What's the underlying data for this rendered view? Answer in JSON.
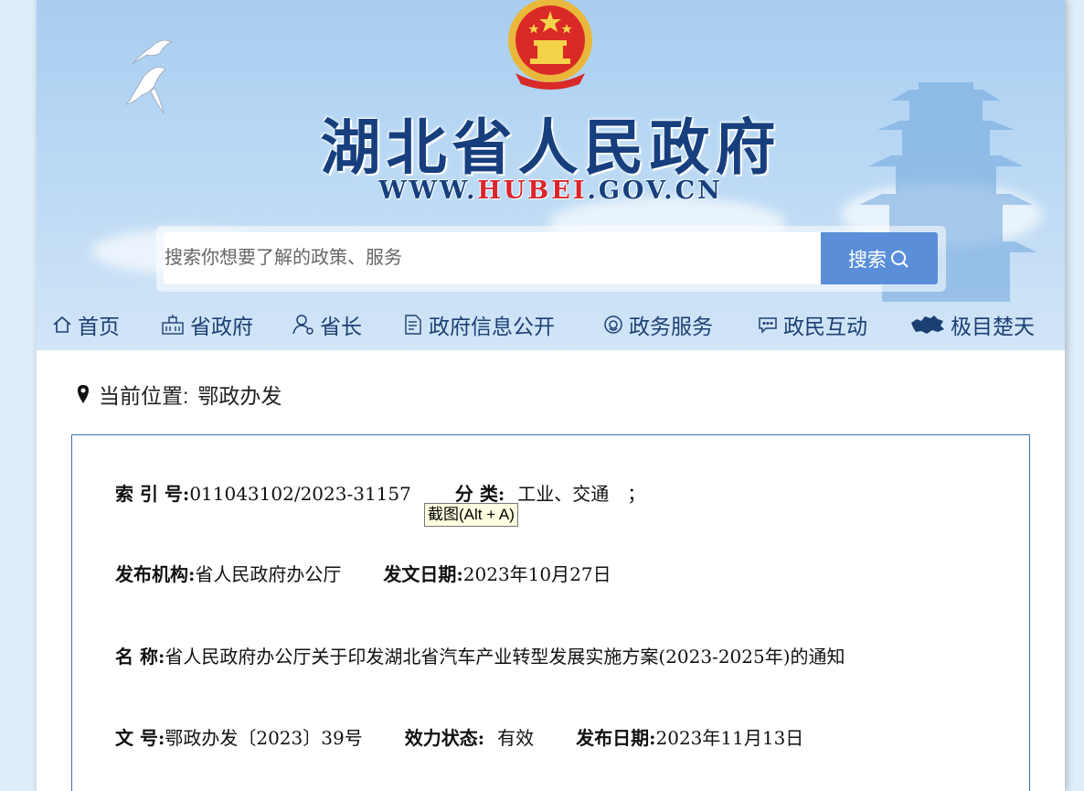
{
  "header": {
    "site_title": "湖北省人民政府",
    "url_prefix": "WWW.",
    "url_middle": "HUBEI",
    "url_suffix": ".GOV.CN"
  },
  "search": {
    "placeholder": "搜索你想要了解的政策、服务",
    "button_label": "搜索"
  },
  "nav": {
    "items": [
      {
        "label": "首页",
        "icon": "home-icon"
      },
      {
        "label": "省政府",
        "icon": "building-icon"
      },
      {
        "label": "省长",
        "icon": "person-icon"
      },
      {
        "label": "政府信息公开",
        "icon": "document-icon"
      },
      {
        "label": "政务服务",
        "icon": "service-icon"
      },
      {
        "label": "政民互动",
        "icon": "chat-icon"
      },
      {
        "label": "极目楚天",
        "icon": "hubei-map-icon"
      }
    ]
  },
  "location": {
    "label": "当前位置:",
    "value": "鄂政办发"
  },
  "document": {
    "index_label": "索 引 号:",
    "index_value": "011043102/2023-31157",
    "category_label": "分 类:",
    "category_value": "工业、交通　；",
    "issuer_label": "发布机构:",
    "issuer_value": "省人民政府办公厅",
    "date_label": "发文日期:",
    "date_value": "2023年10月27日",
    "name_label": "名 称:",
    "name_value": "省人民政府办公厅关于印发湖北省汽车产业转型发展实施方案(2023-2025年)的通知",
    "doc_no_label": "文 号:",
    "doc_no_value": "鄂政办发〔2023〕39号",
    "status_label": "效力状态:",
    "status_value": "有效",
    "publish_label": "发布日期:",
    "publish_value": "2023年11月13日"
  },
  "tooltip": {
    "text": "截图(Alt + A)"
  },
  "colors": {
    "title_blue": "#173f7e",
    "url_red": "#d8262c",
    "search_button": "#5b8ed9",
    "box_border": "#3b6fb6"
  }
}
